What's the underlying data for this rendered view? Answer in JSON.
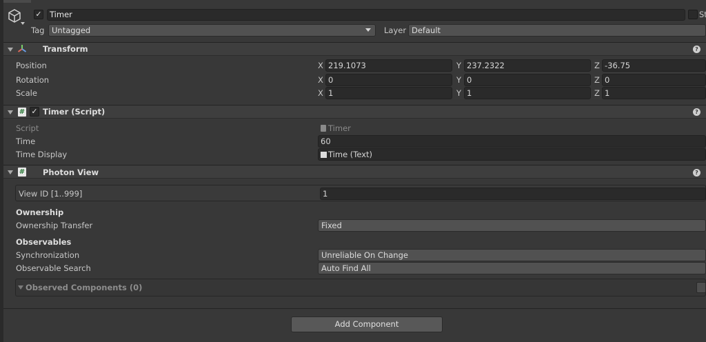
{
  "header": {
    "object_name": "Timer",
    "active_checked": true,
    "static_label": "St",
    "tag_label": "Tag",
    "tag_value": "Untagged",
    "layer_label": "Layer",
    "layer_value": "Default"
  },
  "transform": {
    "title": "Transform",
    "rows": [
      {
        "label": "Position",
        "x": "219.1073",
        "y": "237.2322",
        "z": "-36.75"
      },
      {
        "label": "Rotation",
        "x": "0",
        "y": "0",
        "z": "0"
      },
      {
        "label": "Scale",
        "x": "1",
        "y": "1",
        "z": "1"
      }
    ],
    "axis": {
      "x": "X",
      "y": "Y",
      "z": "Z"
    }
  },
  "timer_script": {
    "title": "Timer (Script)",
    "script_label": "Script",
    "script_value": "Timer",
    "time_label": "Time",
    "time_value": "60",
    "display_label": "Time Display",
    "display_value": "Time (Text)"
  },
  "photon_view": {
    "title": "Photon View",
    "view_id_label": "View ID [1..999]",
    "view_id_value": "1",
    "ownership_heading": "Ownership",
    "ownership_transfer_label": "Ownership Transfer",
    "ownership_transfer_value": "Fixed",
    "observables_heading": "Observables",
    "synchronization_label": "Synchronization",
    "synchronization_value": "Unreliable On Change",
    "observable_search_label": "Observable Search",
    "observable_search_value": "Auto Find All",
    "observed_components_label": "Observed Components (0)"
  },
  "add_component_label": "Add Component",
  "icons": {
    "help": "?",
    "check": "✓",
    "dropdown_arrow": "▼",
    "hash": "#"
  }
}
